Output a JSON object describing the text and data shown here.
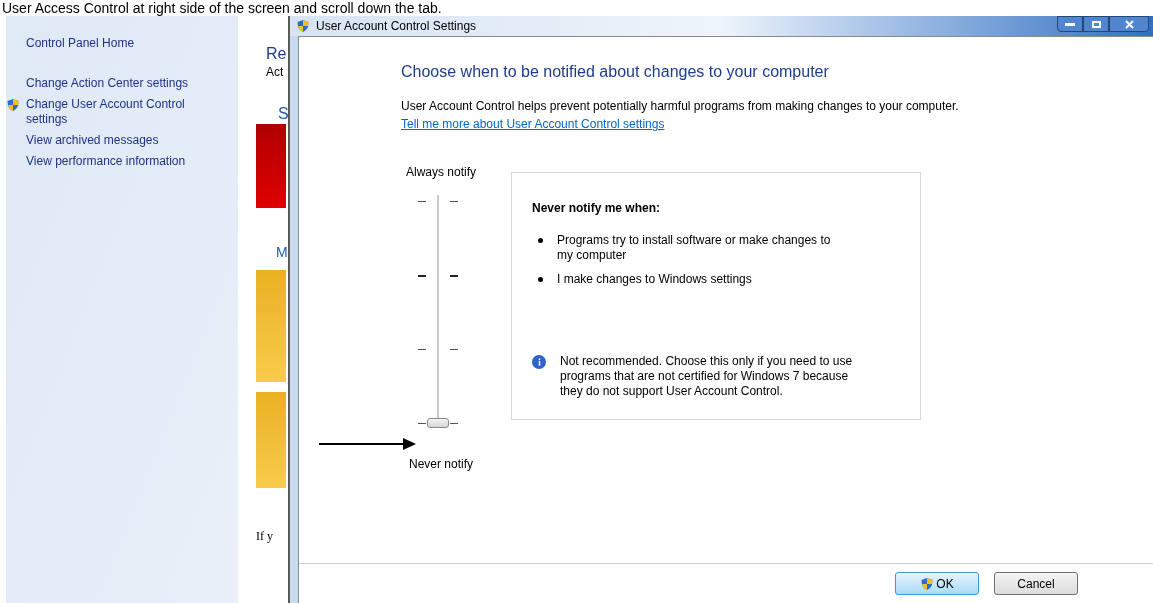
{
  "caption": "User Access Control at right side of the screen and scroll down the tab.",
  "background_window": {
    "sidebar": {
      "items": [
        {
          "label": "Control Panel Home",
          "icon": false
        },
        {
          "label": "Change Action Center settings",
          "icon": false
        },
        {
          "label": "Change User Account Control settings",
          "icon": true
        },
        {
          "label": "View archived messages",
          "icon": false
        },
        {
          "label": "View performance information",
          "icon": false
        }
      ]
    },
    "partial_texts": [
      "Re",
      "Act",
      "S",
      "M",
      "If y"
    ]
  },
  "dialog": {
    "title": "User Account Control Settings",
    "heading": "Choose when to be notified about changes to your computer",
    "description": "User Account Control helps prevent potentially harmful programs from making changes to your computer.",
    "link": "Tell me more about User Account Control settings",
    "slider": {
      "top_label": "Always notify",
      "bottom_label": "Never notify",
      "level": 0
    },
    "info_box": {
      "title": "Never notify me when:",
      "bullets": [
        "Programs try to install software or make changes to my computer",
        "I make changes to Windows settings"
      ],
      "note": "Not recommended. Choose this only if you need to use programs that are not certified for Windows 7 because they do not support User Account Control."
    },
    "buttons": [
      {
        "label": "OK",
        "shield": true
      },
      {
        "label": "Cancel",
        "shield": false
      }
    ]
  }
}
